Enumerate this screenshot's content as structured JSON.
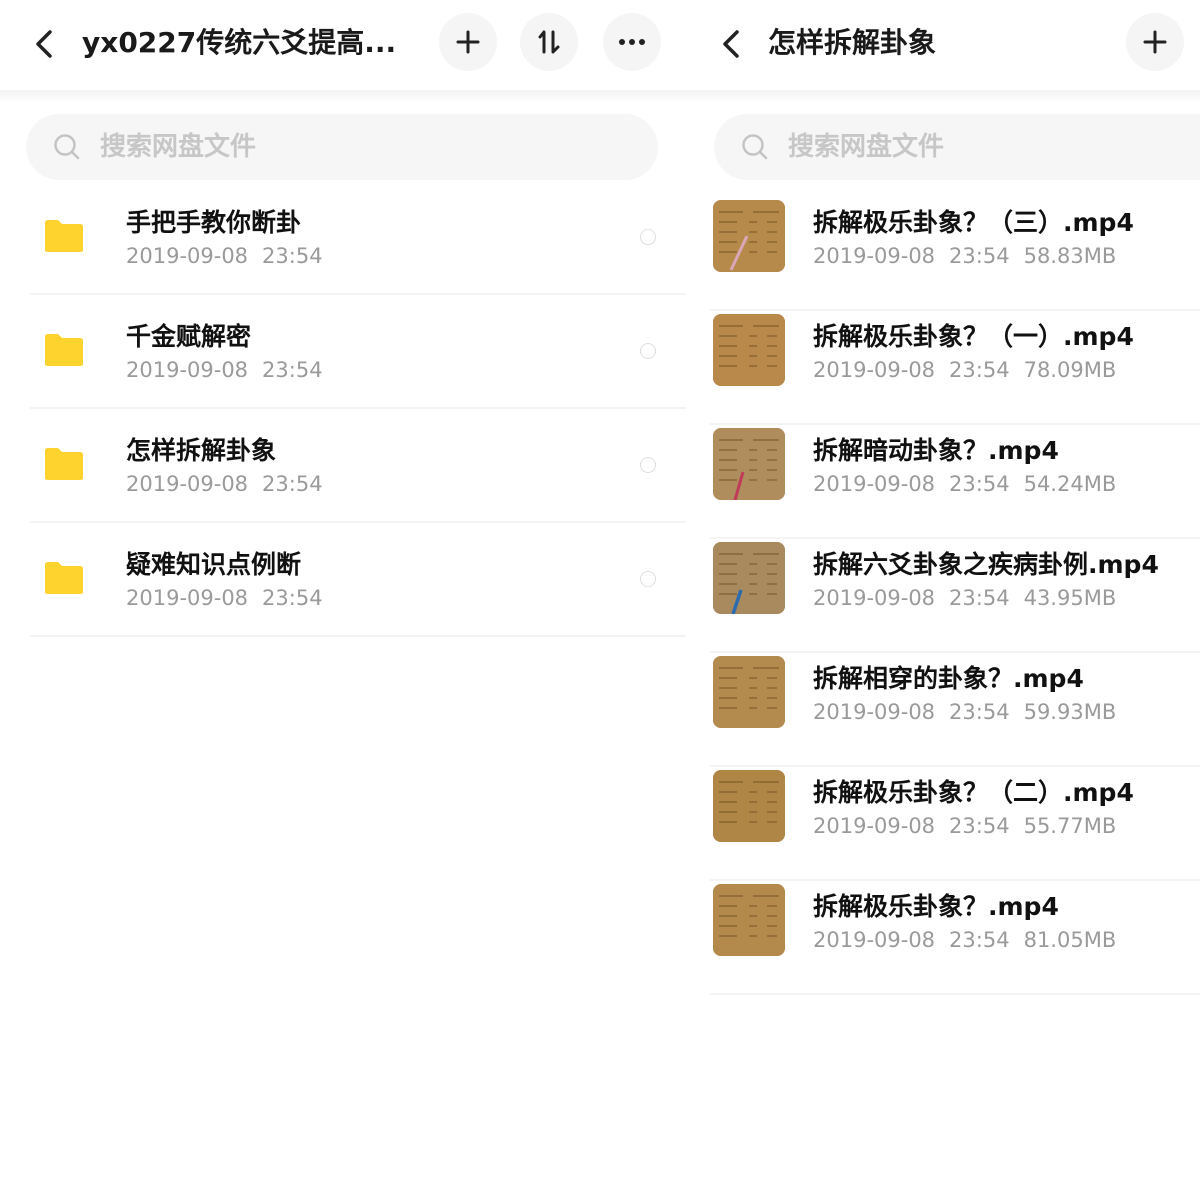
{
  "left": {
    "title": "yx0227传统六爻提高...",
    "search_placeholder": "搜索网盘文件",
    "icons": {
      "back": "chevron-left-icon",
      "add": "plus-icon",
      "sort": "sort-icon",
      "more": "more-dots-icon",
      "search": "search-icon",
      "folder": "folder-icon"
    },
    "folders": [
      {
        "name": "手把手教你断卦",
        "date": "2019-09-08",
        "time": "23:54"
      },
      {
        "name": "千金赋解密",
        "date": "2019-09-08",
        "time": "23:54"
      },
      {
        "name": "怎样拆解卦象",
        "date": "2019-09-08",
        "time": "23:54"
      },
      {
        "name": "疑难知识点例断",
        "date": "2019-09-08",
        "time": "23:54"
      }
    ]
  },
  "right": {
    "title": "怎样拆解卦象",
    "search_placeholder": "搜索网盘文件",
    "icons": {
      "back": "chevron-left-icon",
      "add": "plus-icon",
      "search": "search-icon"
    },
    "files": [
      {
        "name": "拆解极乐卦象？（三）.mp4",
        "date": "2019-09-08",
        "time": "23:54",
        "size": "58.83MB"
      },
      {
        "name": "拆解极乐卦象？（一）.mp4",
        "date": "2019-09-08",
        "time": "23:54",
        "size": "78.09MB"
      },
      {
        "name": "拆解暗动卦象？.mp4",
        "date": "2019-09-08",
        "time": "23:54",
        "size": "54.24MB"
      },
      {
        "name": "拆解六爻卦象之疾病卦例.mp4",
        "date": "2019-09-08",
        "time": "23:54",
        "size": "43.95MB"
      },
      {
        "name": "拆解相穿的卦象？.mp4",
        "date": "2019-09-08",
        "time": "23:54",
        "size": "59.93MB"
      },
      {
        "name": "拆解极乐卦象？（二）.mp4",
        "date": "2019-09-08",
        "time": "23:54",
        "size": "55.77MB"
      },
      {
        "name": "拆解极乐卦象？.mp4",
        "date": "2019-09-08",
        "time": "23:54",
        "size": "81.05MB"
      }
    ]
  },
  "colors": {
    "folder": "#FFD32E",
    "thumbnail": "#B58A4A",
    "title": "#1A1A1A",
    "meta": "#9A9A9A",
    "placeholder": "#C7C7C7",
    "button_bg": "#F5F5F5"
  }
}
